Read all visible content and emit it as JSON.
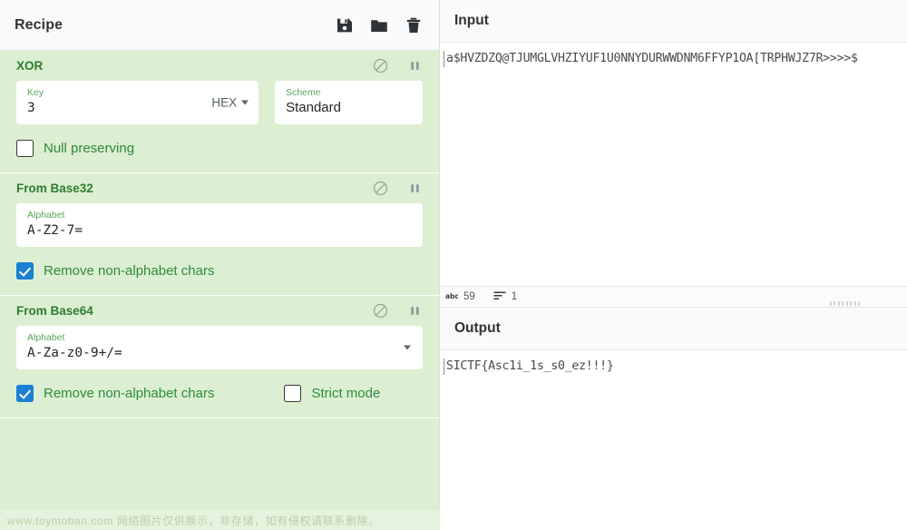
{
  "recipe": {
    "title": "Recipe",
    "tools": [
      {
        "name": "save-recipe-icon",
        "label": "Save recipe"
      },
      {
        "name": "load-recipe-icon",
        "label": "Load recipe"
      },
      {
        "name": "clear-recipe-icon",
        "label": "Clear recipe"
      }
    ],
    "operations": [
      {
        "name": "XOR",
        "controls": [
          {
            "name": "disable-operation-icon",
            "label": "Disable operation"
          },
          {
            "name": "pause-operation-icon",
            "label": "Set breakpoint"
          }
        ],
        "fields": [
          {
            "label": "Key",
            "value": "3",
            "suffix": "HEX",
            "has_dropdown": true
          },
          {
            "label": "Scheme",
            "value": "Standard",
            "has_dropdown": false
          }
        ],
        "checkboxes": [
          {
            "label": "Null preserving",
            "checked": false
          }
        ]
      },
      {
        "name": "From Base32",
        "controls": [
          {
            "name": "disable-operation-icon",
            "label": "Disable operation"
          },
          {
            "name": "pause-operation-icon",
            "label": "Set breakpoint"
          }
        ],
        "fields": [
          {
            "label": "Alphabet",
            "value": "A-Z2-7=",
            "has_dropdown": false
          }
        ],
        "checkboxes": [
          {
            "label": "Remove non-alphabet chars",
            "checked": true
          }
        ]
      },
      {
        "name": "From Base64",
        "controls": [
          {
            "name": "disable-operation-icon",
            "label": "Disable operation"
          },
          {
            "name": "pause-operation-icon",
            "label": "Set breakpoint"
          }
        ],
        "fields": [
          {
            "label": "Alphabet",
            "value": "A-Za-z0-9+/=",
            "has_dropdown": true
          }
        ],
        "checkboxes": [
          {
            "label": "Remove non-alphabet chars",
            "checked": true
          },
          {
            "label": "Strict mode",
            "checked": false
          }
        ]
      }
    ]
  },
  "input": {
    "title": "Input",
    "text": "a$HVZDZQ@TJUMGLVHZIYUF1U0NNYDURWWDNM6FFYP1OA[TRPHWJZ7R>>>>$",
    "status": {
      "length_icon": "abc-characters-icon",
      "length": "59",
      "lines_icon": "lines-count-icon",
      "lines": "1"
    }
  },
  "output": {
    "title": "Output",
    "text": "SICTF{Asc1i_1s_s0_ez!!!}"
  },
  "watermark": {
    "text": "www.toymoban.com 网络图片仅供展示，非存储，如有侵权请联系删除。"
  },
  "colors": {
    "recipe_background": "#dcefd2",
    "operation_title": "#2e7d32",
    "checkbox_label": "#2e8b3d",
    "checkbox_checked": "#1b7fd4",
    "field_label": "#5aa55e",
    "panel_header": "#fafafa"
  }
}
